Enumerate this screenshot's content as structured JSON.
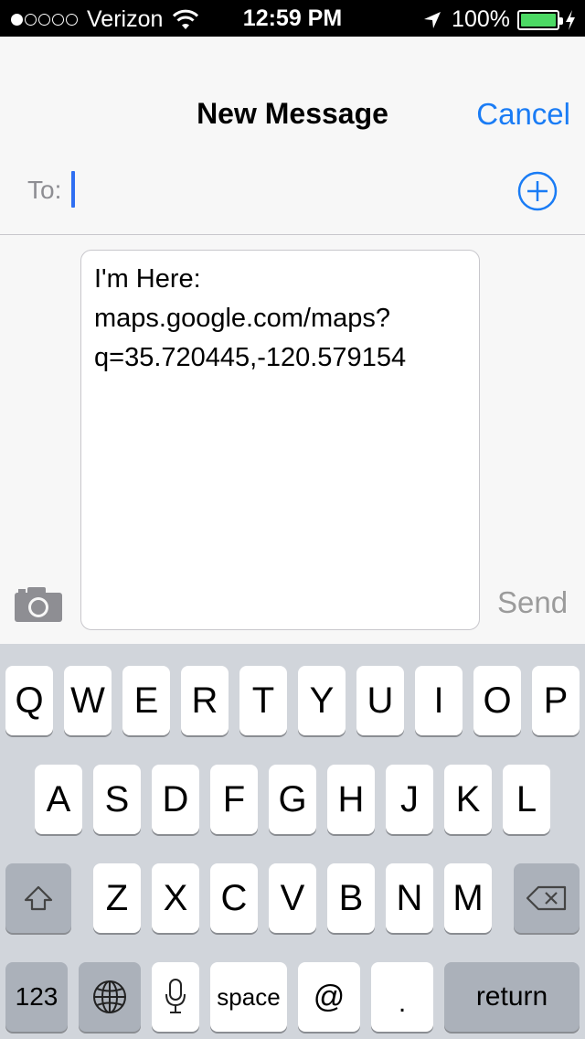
{
  "status_bar": {
    "carrier": "Verizon",
    "time": "12:59 PM",
    "battery": "100%",
    "battery_fill": 1.0
  },
  "nav": {
    "title": "New Message",
    "cancel": "Cancel"
  },
  "recipient": {
    "label": "To:"
  },
  "message": {
    "line1": "I'm Here:",
    "line2": "maps.google.com/maps?",
    "line3": "q=35.720445,-120.579154",
    "send": "Send"
  },
  "keyboard": {
    "row1": [
      "Q",
      "W",
      "E",
      "R",
      "T",
      "Y",
      "U",
      "I",
      "O",
      "P"
    ],
    "row2": [
      "A",
      "S",
      "D",
      "F",
      "G",
      "H",
      "J",
      "K",
      "L"
    ],
    "row3": [
      "Z",
      "X",
      "C",
      "V",
      "B",
      "N",
      "M"
    ],
    "num": "123",
    "space": "space",
    "at": "@",
    "dot": ".",
    "return": "return"
  },
  "colors": {
    "accent": "#1a7cf5",
    "battery": "#4cd964",
    "cursor": "#2f6ff2"
  },
  "icons": [
    "signal-dots-icon",
    "wifi-icon",
    "location-arrow-icon",
    "battery-icon",
    "charging-bolt-icon",
    "add-contact-icon",
    "camera-icon",
    "shift-icon",
    "delete-icon",
    "globe-icon",
    "microphone-icon"
  ]
}
